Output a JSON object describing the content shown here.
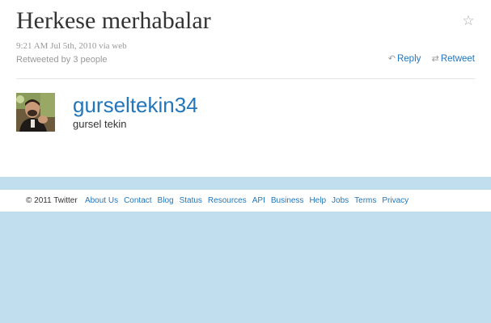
{
  "tweet": {
    "text": "Herkese merhabalar",
    "timestamp": "9:21 AM Jul 5th, 2010",
    "via": "via web",
    "retweeted_by": "Retweeted by 3 people",
    "favorite_icon": "star-icon"
  },
  "actions": {
    "reply_label": "Reply",
    "retweet_label": "Retweet",
    "reply_icon": "reply-arrow-icon",
    "retweet_icon": "retweet-icon"
  },
  "author": {
    "screen_name": "gurseltekin34",
    "full_name": "gursel tekin"
  },
  "footer": {
    "copyright": "© 2011 Twitter",
    "links": [
      "About Us",
      "Contact",
      "Blog",
      "Status",
      "Resources",
      "API",
      "Business",
      "Help",
      "Jobs",
      "Terms",
      "Privacy"
    ]
  },
  "colors": {
    "background": "#c0deed",
    "link": "#2276bb",
    "text": "#333333",
    "muted": "#999999"
  }
}
